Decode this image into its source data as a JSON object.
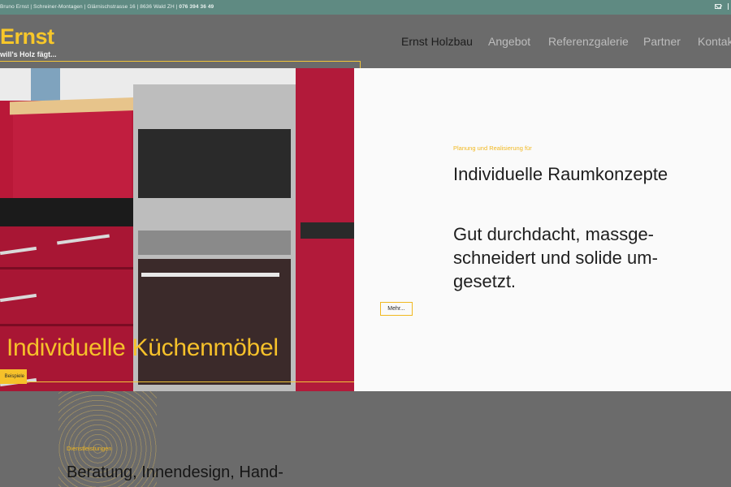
{
  "topbar": {
    "info": "Bruno Ernst | Schreiner-Montagen | Glärnischstrasse 16 | 8636 Wald ZH | ",
    "phone": "076 394 36 49",
    "mail_icon": "mail-icon"
  },
  "logo": {
    "name": "Ernst",
    "tagline": "will's Holz fägt..."
  },
  "nav": {
    "items": [
      {
        "label": "Ernst Holzbau",
        "active": true
      },
      {
        "label": "Angebot"
      },
      {
        "label": "Referenzgalerie"
      },
      {
        "label": "Partner"
      },
      {
        "label": "Kontakt"
      }
    ]
  },
  "hero": {
    "image_title": "Individuelle Küchenmöbel",
    "button_label": "Beispiele",
    "kicker": "Planung und Realisierung für",
    "headline": "Individuelle Raumkonzepte",
    "subline": "Gut durchdacht, massge-schneidert und solide um-gesetzt.",
    "more_label": "Mehr..."
  },
  "services": {
    "kicker": "Dienstleistungen",
    "title": "Beratung, Innendesign, Hand-"
  },
  "colors": {
    "accent": "#f6c12a",
    "topbar": "#5f8a82",
    "background": "#6b6b6b",
    "kitchen_red": "#b91838"
  }
}
